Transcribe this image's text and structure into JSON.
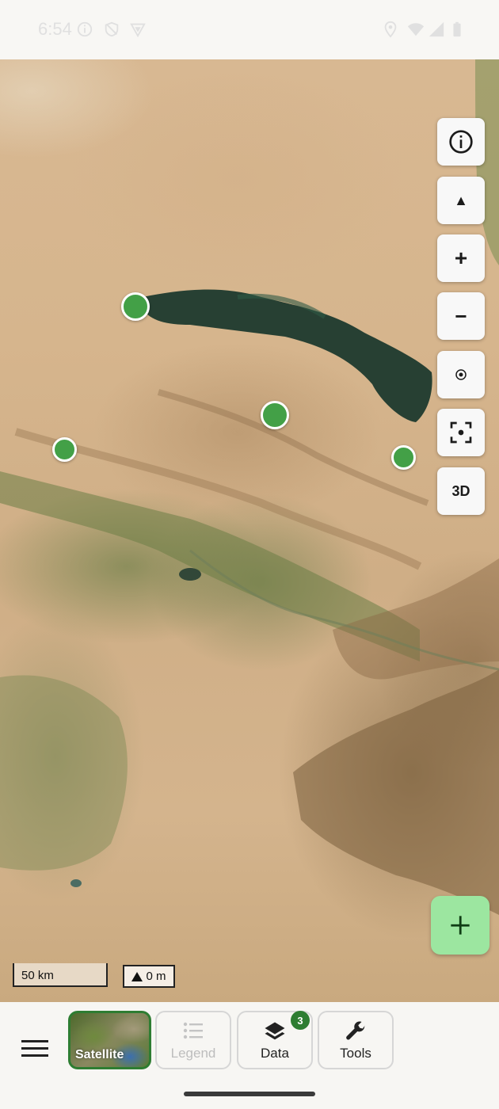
{
  "status_bar": {
    "time": "6:54",
    "icons": [
      "info-icon",
      "shield-icon",
      "vpn-icon",
      "location-icon",
      "wifi-icon",
      "signal-icon",
      "battery-icon"
    ]
  },
  "map": {
    "markers": 4,
    "marker_color": "#43a047"
  },
  "controls": {
    "info": "info-icon",
    "compass": "▲",
    "zoom_in": "+",
    "zoom_out": "−",
    "my_location": "my-location-icon",
    "focus": "focus-frame-icon",
    "view_3d": "3D"
  },
  "fab": {
    "icon": "+",
    "color": "#9ce6a0"
  },
  "scale": {
    "distance": "50 km",
    "elevation": "0 m"
  },
  "bottom_nav": {
    "menu_icon": "hamburger-icon",
    "tabs": [
      {
        "label": "Satellite",
        "icon": "satellite-thumbnail",
        "selected": true
      },
      {
        "label": "Legend",
        "icon": "list-icon",
        "disabled": true
      },
      {
        "label": "Data",
        "icon": "layers-icon",
        "badge": "3"
      },
      {
        "label": "Tools",
        "icon": "wrench-icon"
      }
    ],
    "accent": "#2e7d32"
  }
}
